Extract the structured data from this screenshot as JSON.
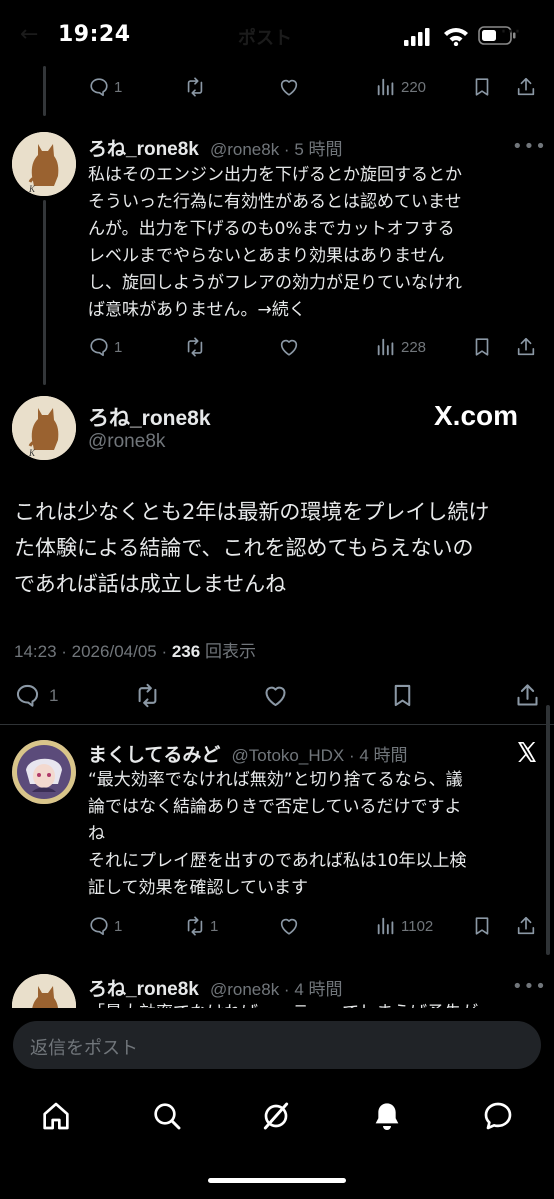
{
  "status_bar": {
    "time": "19:24"
  },
  "header_ghost": {
    "title": "ポスト"
  },
  "prev_tweet_actions": {
    "replies": "1",
    "views": "220"
  },
  "tweet_1": {
    "name": "ろね_rone8k",
    "handle_time": "@rone8k · 5 時間",
    "text": "私はそのエンジン出力を下げるとか旋回するとか\nそういった行為に有効性があるとは認めていませ\nんが。出力を下げるのも0%までカットオフする\nレベルまでやらないとあまり効果はありません\nし、旋回しようがフレアの効力が足りていなけれ\nば意味がありません。→続く",
    "replies": "1",
    "views": "228"
  },
  "main_tweet": {
    "name": "ろね_rone8k",
    "handle": "@rone8k",
    "brand": "X.com",
    "text": "これは少なくとも2年は最新の環境をプレイし続け\nた体験による結論で、これを認めてもらえないの\nであれば話は成立しませんね",
    "timestamp": "14:23 · 2026/04/05 · ",
    "views_count": "236",
    "views_label": " 回表示",
    "replies": "1"
  },
  "reply_1": {
    "name": "まくしてるみど",
    "handle_time": "@Totoko_HDX · 4 時間",
    "text": "“最大効率でなければ無効”と切り捨てるなら、議\n論ではなく結論ありきで否定しているだけですよ\nね\nそれにプレイ歴を出すのであれば私は10年以上検\n証して効果を確認しています",
    "replies": "1",
    "retweets": "1",
    "views": "1102"
  },
  "reply_2": {
    "name": "ろね_rone8k",
    "handle_time": "@rone8k · 4 時間",
    "text": "「最大効率でなければ……テ」ってしまうば矛先が"
  },
  "composer": {
    "placeholder": "返信をポスト"
  },
  "colors": {
    "background": "#000000",
    "text": "#e7e9ea",
    "muted": "#71767b",
    "divider": "#2f3336"
  },
  "bottom_nav": [
    "home-icon",
    "search-icon",
    "grok-icon",
    "notifications-icon",
    "messages-icon"
  ]
}
